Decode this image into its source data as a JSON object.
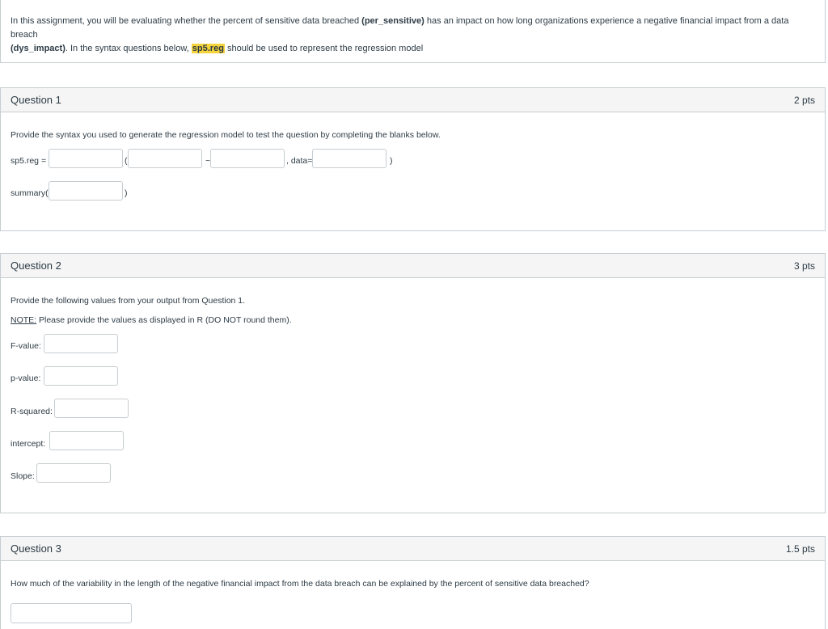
{
  "intro": {
    "part1": "In this assignment, you will be evaluating whether the percent of sensitive data breached ",
    "var1": "(per_sensitive)",
    "part2": " has an impact on how long organizations experience a negative financial impact from a data breach",
    "var2": "(dys_impact)",
    "part3": ". In the syntax questions below, ",
    "highlight": "sp5.reg",
    "part4": " should be used to represent the regression model"
  },
  "q1": {
    "title": "Question 1",
    "points": "2 pts",
    "prompt": "Provide the syntax you used to generate the regression model to test the question by completing the blanks below.",
    "reg_label": "sp5.reg =",
    "open_paren": "(",
    "tilde": "~",
    "data_label": ", data=",
    "close_paren": ")",
    "summary_label": "summary(",
    "summary_close": ")"
  },
  "q2": {
    "title": "Question 2",
    "points": "3 pts",
    "prompt": "Provide the following values from your output from Question 1.",
    "note_label": "NOTE:",
    "note_text": " Please provide the values as displayed in R (DO NOT round them).",
    "f_label": "F-value:",
    "p_label": "p-value:",
    "r_label": "R-squared:",
    "i_label": "intercept:",
    "s_label": "Slope:"
  },
  "q3": {
    "title": "Question 3",
    "points": "1.5 pts",
    "prompt": "How much of the variability in the length of the negative financial impact from the data breach can be explained by the percent of sensitive data breached?"
  }
}
